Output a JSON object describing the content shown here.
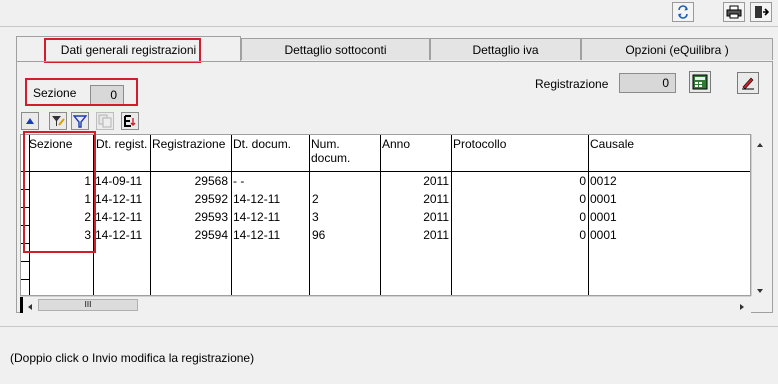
{
  "toolbar": {
    "icons": [
      "refresh-icon",
      "print-icon",
      "exit-icon"
    ]
  },
  "tabs": [
    {
      "label": "Dati generali registrazioni",
      "active": true
    },
    {
      "label": "Dettaglio sottoconti",
      "active": false
    },
    {
      "label": "Dettaglio iva",
      "active": false
    },
    {
      "label": "Opzioni (eQuilibra )",
      "active": false
    }
  ],
  "sezione": {
    "label": "Sezione",
    "value": "0"
  },
  "registrazione": {
    "label": "Registrazione",
    "value": "0"
  },
  "grid": {
    "columns": [
      "Sezione",
      "Dt. regist.",
      "Registrazione",
      "Dt. docum.",
      "Num.\ndocum.",
      "Anno",
      "Protocollo",
      "Causale"
    ],
    "rows": [
      {
        "sezione": "1",
        "dt_regist": "14-09-11",
        "registrazione": "29568",
        "dt_docum": "-  -",
        "num_docum": "",
        "anno": "2011",
        "protocollo": "0",
        "causale": "0012"
      },
      {
        "sezione": "1",
        "dt_regist": "14-12-11",
        "registrazione": "29592",
        "dt_docum": "14-12-11",
        "num_docum": "2",
        "anno": "2011",
        "protocollo": "0",
        "causale": "0001"
      },
      {
        "sezione": "2",
        "dt_regist": "14-12-11",
        "registrazione": "29593",
        "dt_docum": "14-12-11",
        "num_docum": "3",
        "anno": "2011",
        "protocollo": "0",
        "causale": "0001"
      },
      {
        "sezione": "3",
        "dt_regist": "14-12-11",
        "registrazione": "29594",
        "dt_docum": "14-12-11",
        "num_docum": "96",
        "anno": "2011",
        "protocollo": "0",
        "causale": "0001"
      }
    ],
    "hscroll_thumb": "III"
  },
  "status": "(Doppio click o Invio modifica la registrazione)",
  "colors": {
    "highlight": "#d01f2b",
    "field_bg": "#d8d8d8"
  }
}
